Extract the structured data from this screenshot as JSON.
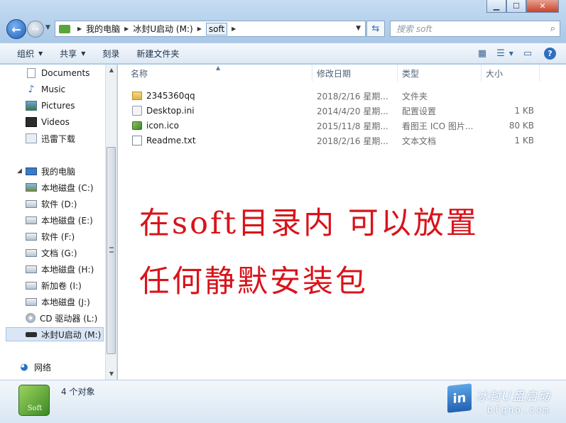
{
  "address": {
    "crumbs": [
      "我的电脑",
      "冰封U启动 (M:)",
      "soft"
    ]
  },
  "search": {
    "placeholder": "搜索 soft"
  },
  "toolbar": {
    "organize": "组织",
    "share": "共享",
    "burn": "刻录",
    "new_folder": "新建文件夹"
  },
  "nav": {
    "libraries": [
      "Documents",
      "Music",
      "Pictures",
      "Videos",
      "迅雷下载"
    ],
    "computer": "我的电脑",
    "drives": [
      "本地磁盘 (C:)",
      "软件 (D:)",
      "本地磁盘 (E:)",
      "软件 (F:)",
      "文档 (G:)",
      "本地磁盘 (H:)",
      "新加卷 (I:)",
      "本地磁盘 (J:)",
      "CD 驱动器 (L:)",
      "冰封U启动 (M:)"
    ],
    "network": "网络"
  },
  "columns": {
    "name": "名称",
    "date": "修改日期",
    "type": "类型",
    "size": "大小"
  },
  "files": [
    {
      "name": "2345360qq",
      "date": "2018/2/16 星期...",
      "type": "文件夹",
      "size": "",
      "icon": "folder-icon"
    },
    {
      "name": "Desktop.ini",
      "date": "2014/4/20 星期...",
      "type": "配置设置",
      "size": "1 KB",
      "icon": "settings-file-icon"
    },
    {
      "name": "icon.ico",
      "date": "2015/11/8 星期...",
      "type": "看图王 ICO 图片...",
      "size": "80 KB",
      "icon": "image-file-icon"
    },
    {
      "name": "Readme.txt",
      "date": "2018/2/16 星期...",
      "type": "文本文档",
      "size": "1 KB",
      "icon": "text-file-icon"
    }
  ],
  "annotation": {
    "line1": "在soft目录内 可以放置",
    "line2": "任何静默安装包"
  },
  "details": {
    "icon_label": "Soft",
    "count": "4 个对象"
  },
  "watermark": {
    "badge": "in",
    "text1": "冰封U盘启动",
    "text2": "bfgho.com"
  },
  "colors": {
    "annotation": "#d8141b",
    "selection": "#d9e6f5",
    "chrome": "#a9c9e8"
  }
}
